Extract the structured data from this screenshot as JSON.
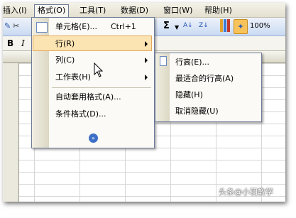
{
  "menubar": {
    "items": [
      "插入(I)",
      "格式(O)",
      "工具(T)",
      "数据(D)",
      "窗口(W)",
      "帮助(H)"
    ]
  },
  "toolbar": {
    "sigma": "Σ",
    "sort_asc": "A↓",
    "sort_desc": "Z↓",
    "zoom": "100%"
  },
  "format_menu": {
    "items": [
      {
        "label": "单元格(E)...",
        "shortcut": "Ctrl+1"
      },
      {
        "label": "行(R)"
      },
      {
        "label": "列(C)"
      },
      {
        "label": "工作表(H)"
      },
      {
        "label": "自动套用格式(A)..."
      },
      {
        "label": "条件格式(D)..."
      }
    ],
    "expand": "»"
  },
  "row_submenu": {
    "items": [
      "行高(E)...",
      "最适合的行高(A)",
      "隐藏(H)",
      "取消隐藏(U)"
    ]
  },
  "left_toolbar": {
    "bold": "B",
    "italic": "I"
  },
  "watermark": "头条@小羽教学"
}
